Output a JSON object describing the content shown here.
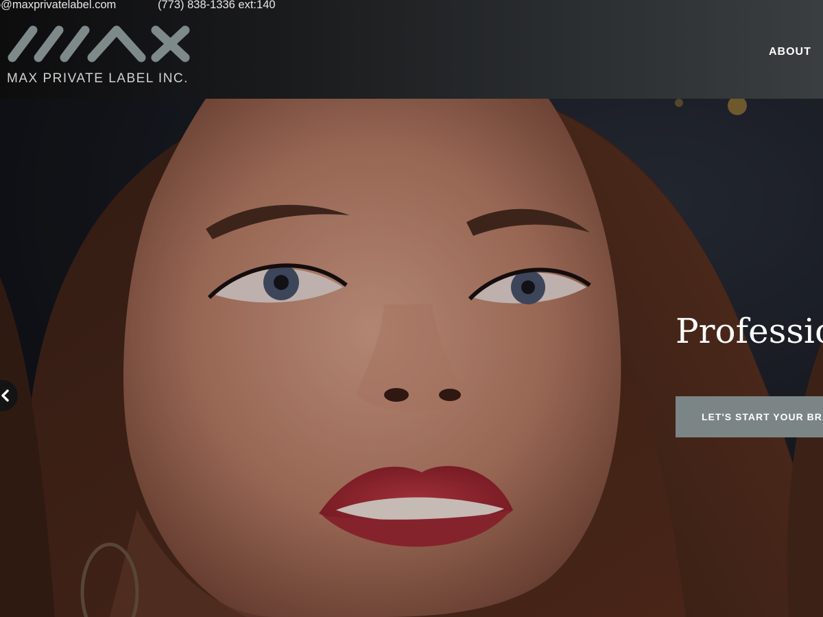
{
  "topbar": {
    "email": "o@maxprivatelabel.com",
    "phone": "(773) 838-1336 ext:140"
  },
  "logo": {
    "name": "MAX PRIVATE LABEL INC.",
    "mark_color": "#7e898a"
  },
  "nav": {
    "items": [
      {
        "label": "ABOUT"
      }
    ]
  },
  "hero": {
    "title": "Professio",
    "cta_label": "LET'S START YOUR BRA",
    "cta_color": "#7b8586",
    "prev_icon": "chevron-left-icon"
  }
}
